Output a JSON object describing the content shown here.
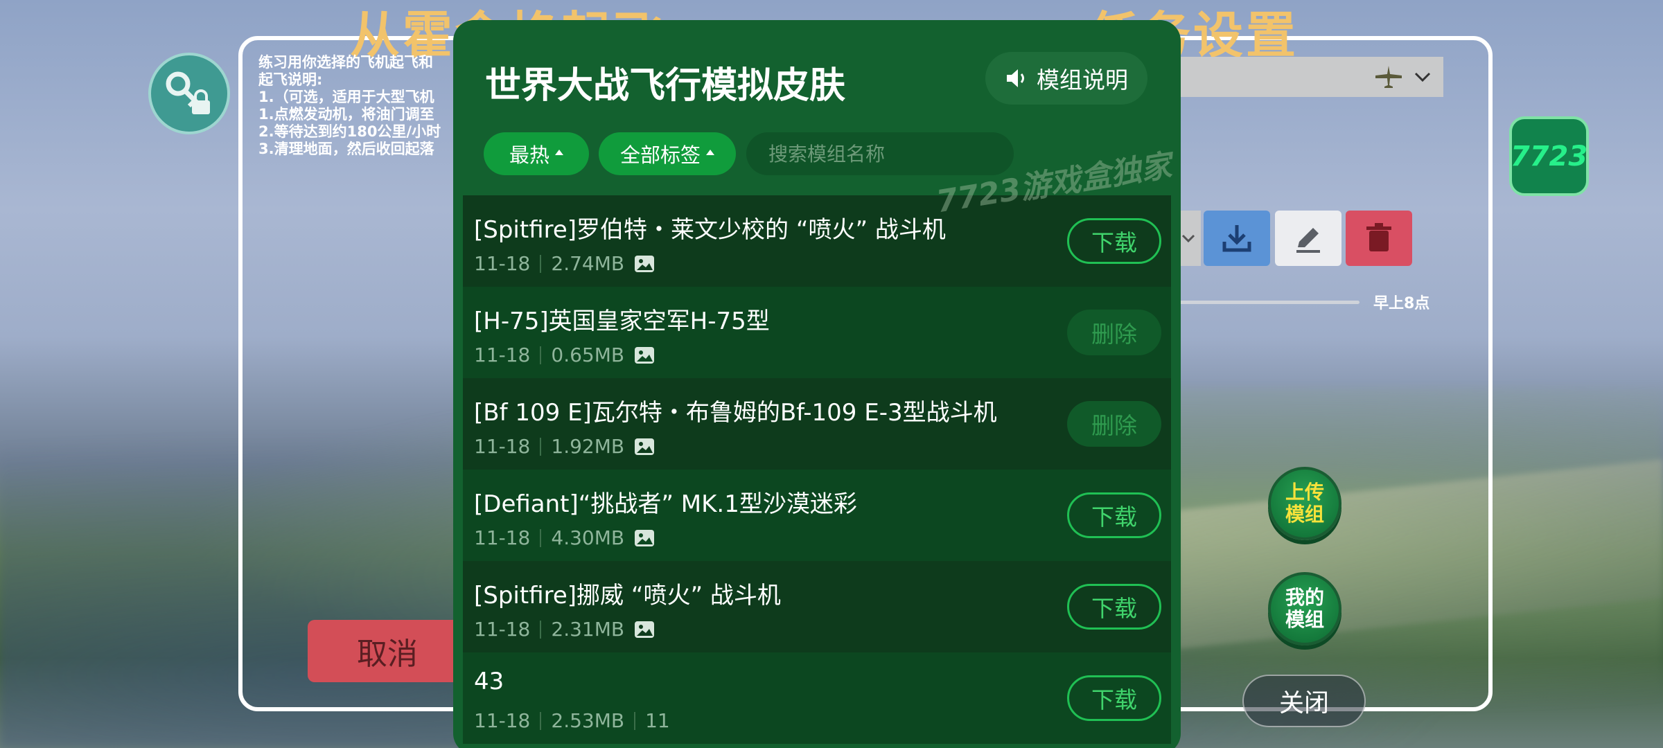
{
  "background": {
    "title_left": "从霍金格起飞",
    "title_right": "任务设置",
    "instructions": "练习用你选择的飞机起飞和\n起飞说明:\n1.（可选，适用于大型飞机\n1.点燃发动机，将油门调至\n2.等待达到约180公里/小时\n3.清理地面，然后收回起落",
    "cancel_label": "取消",
    "time_label": "早上8点",
    "badge_label": "7723",
    "upload_label": "上传\n模组",
    "my_mods_label": "我的\n模组",
    "close_label": "关闭"
  },
  "panel": {
    "title": "世界大战飞行模拟皮肤",
    "mod_info_label": "模组说明",
    "filters": {
      "hot_label": "最热",
      "tags_label": "全部标签"
    },
    "search": {
      "placeholder": "搜索模组名称"
    },
    "watermark": "7723游戏盒独家"
  },
  "mods": [
    {
      "title": "[Spitfire]罗伯特・莱文少校的 “喷火” 战斗机",
      "date": "11-18",
      "size": "2.74MB",
      "extra": "",
      "action": "下载",
      "action_type": "download"
    },
    {
      "title": "[H-75]英国皇家空军H-75型",
      "date": "11-18",
      "size": "0.65MB",
      "extra": "",
      "action": "删除",
      "action_type": "delete"
    },
    {
      "title": "[Bf 109 E]瓦尔特・布鲁姆的Bf-109 E-3型战斗机",
      "date": "11-18",
      "size": "1.92MB",
      "extra": "",
      "action": "删除",
      "action_type": "delete"
    },
    {
      "title": "[Defiant]“挑战者” MK.1型沙漠迷彩",
      "date": "11-18",
      "size": "4.30MB",
      "extra": "",
      "action": "下载",
      "action_type": "download"
    },
    {
      "title": "[Spitfire]挪威 “喷火” 战斗机",
      "date": "11-18",
      "size": "2.31MB",
      "extra": "",
      "action": "下载",
      "action_type": "download"
    },
    {
      "title": "43",
      "date": "11-18",
      "size": "2.53MB",
      "extra": "11",
      "action": "下载",
      "action_type": "download"
    }
  ],
  "colors": {
    "panel_bg": "#13612f",
    "accent_green": "#109c3c",
    "download_border": "#20c054"
  }
}
